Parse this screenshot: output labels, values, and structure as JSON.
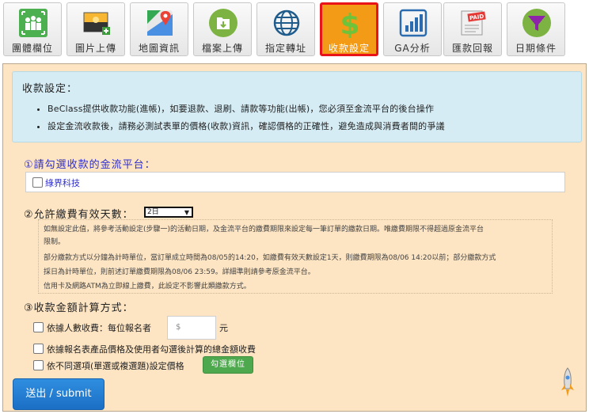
{
  "toolbar": {
    "items": [
      {
        "label": "團體欄位",
        "icon": "group-fields-icon"
      },
      {
        "label": "圖片上傳",
        "icon": "image-upload-icon"
      },
      {
        "label": "地圖資訊",
        "icon": "map-icon"
      },
      {
        "label": "檔案上傳",
        "icon": "file-upload-icon"
      },
      {
        "label": "指定轉址",
        "icon": "globe-icon"
      },
      {
        "label": "收款設定",
        "icon": "dollar-icon",
        "active": true
      },
      {
        "label": "GA分析",
        "icon": "bar-chart-icon"
      },
      {
        "label": "匯款回報",
        "icon": "paid-icon"
      },
      {
        "label": "日期條件",
        "icon": "funnel-icon"
      }
    ],
    "colors": {
      "active_bg": "#f39a16",
      "active_border": "#e8141a"
    }
  },
  "info": {
    "title": "收款設定：",
    "bullets": [
      "BeClass提供收款功能(進帳)，如要退款、退刷、請款等功能(出帳)，您必須至金流平台的後台操作",
      "設定金流收款後，請務必測試表單的價格(收款)資訊，確認價格的正確性，避免造成與消費者間的爭議"
    ]
  },
  "gateway": {
    "title": "①請勾選收款的金流平台：",
    "option": "綠界科技"
  },
  "validity": {
    "title": "②允許繳費有效天數：",
    "selected": "2日",
    "notes": [
      "如無設定此值，將參考活動設定(步驟一)的活動日期，及金流平台的繳費期限來設定每一筆訂單的繳款日期。唯繳費期限不得超過原金流平台",
      "限制。",
      "部分繳款方式以分鐘為計時單位，當訂單成立時間為08/05的14:20，如繳費有效天數設定1天，則繳費期限為08/06 14:20以前；部分繳款方式",
      "採日為計時單位，則前述訂單繳費期限為08/06 23:59。詳細準則請參考原金流平台。",
      "信用卡及網路ATM為立即線上繳費，此設定不影響此類繳款方式。"
    ]
  },
  "amount": {
    "title": "③收款金額計算方式：",
    "option1": "依據人數收費：每位報名者",
    "placeholder": "$",
    "unit": "元",
    "option2": "依據報名表產品價格及使用者勾選後計算的總金額收費",
    "option3": "依不同選項(單選或複選題)設定價格",
    "pick_button": "勾選欄位"
  },
  "submit_label": "送出 / submit"
}
